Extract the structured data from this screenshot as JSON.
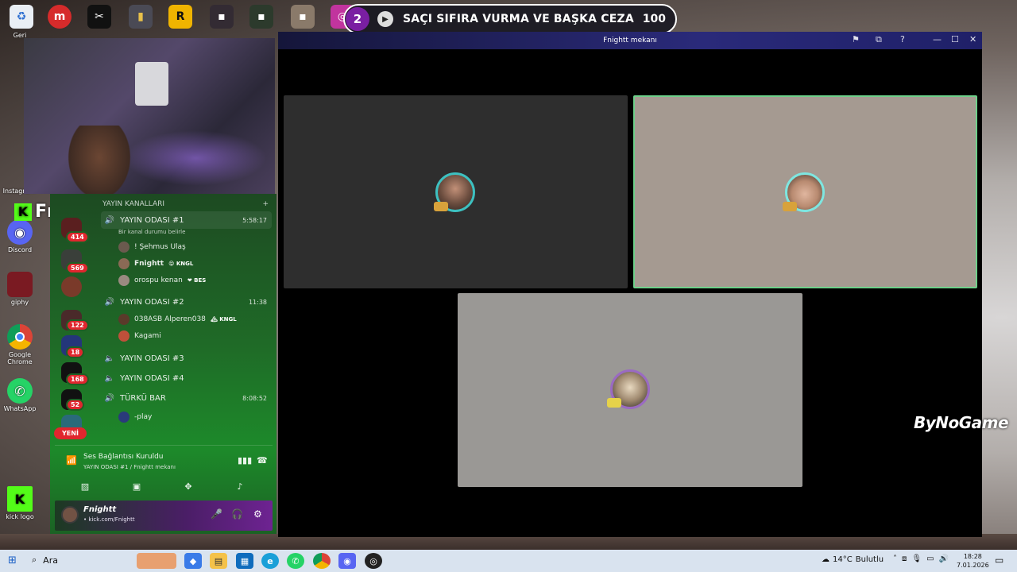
{
  "now_playing": {
    "position": "2",
    "title": "SAÇI SIFIRA VURMA VE BAŞKA CEZA",
    "score": "100"
  },
  "desktop": {
    "icons": [
      {
        "label": "Geri"
      },
      {
        "label": "Instagram"
      },
      {
        "label": "Discord"
      },
      {
        "label": "giphy"
      },
      {
        "label": "Google Chrome"
      },
      {
        "label": "WhatsApp"
      },
      {
        "label": "kick logo"
      }
    ]
  },
  "brand": {
    "kick_name": "Fnightt",
    "kick_letter": "K",
    "bynogame": "ByNoGame"
  },
  "discord": {
    "category": "YAYIN KANALLARI",
    "add_symbol": "+",
    "new_badge": "YENİ",
    "server_badges": [
      "414",
      "569",
      "122",
      "18",
      "168",
      "52"
    ],
    "channels": [
      {
        "name": "YAYIN ODASI #1",
        "time": "5:58:17",
        "status": "Bir kanal durumu belirle",
        "members": [
          {
            "name": "! Şehmus Ulaş",
            "tag": ""
          },
          {
            "name": "Fnightt",
            "tag": "😝 KNGL"
          },
          {
            "name": "orospu kenan",
            "tag": "❤ BES"
          }
        ]
      },
      {
        "name": "YAYIN ODASI #2",
        "time": "11:38",
        "members": [
          {
            "name": "038ASB Alperen038",
            "tag": "🏔 KNGL"
          },
          {
            "name": "Kagami",
            "tag": ""
          }
        ]
      },
      {
        "name": "YAYIN ODASI #3",
        "time": ""
      },
      {
        "name": "YAYIN ODASI #4",
        "time": ""
      },
      {
        "name": "TÜRKÜ BAR",
        "time": "8:08:52",
        "members": [
          {
            "name": "-play",
            "tag": ""
          }
        ]
      }
    ],
    "voice": {
      "status": "Ses Bağlantısı Kuruldu",
      "location": "YAYIN ODASI #1 / Fnightt mekanı"
    },
    "user": {
      "name": "Fnightt",
      "subtitle": "• kick.com/Fnightt"
    }
  },
  "call_window": {
    "title": "Fnightt mekanı"
  },
  "taskbar": {
    "search": "Ara",
    "weather_temp": "14°C",
    "weather_text": "Bulutlu",
    "time": "18:28",
    "date": "7.01.2026"
  },
  "colors": {
    "discord_green": "#1f6b27",
    "kick_green": "#53fc18",
    "badge_red": "#e0262e",
    "call_bar": "#2a2a7a"
  }
}
